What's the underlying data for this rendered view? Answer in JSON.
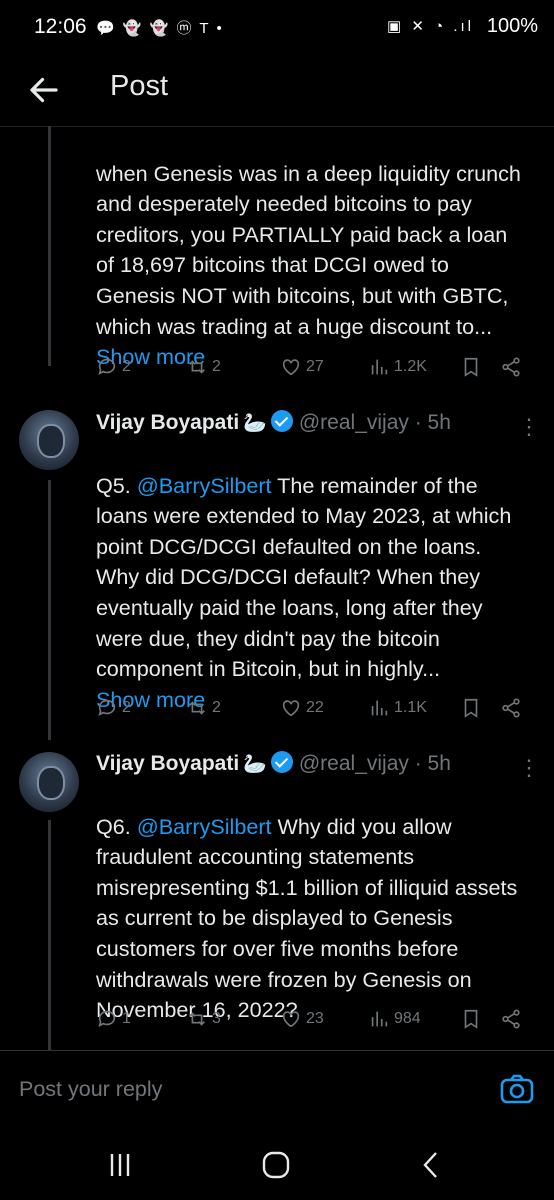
{
  "status_bar": {
    "time": "12:06",
    "notifications": "💬 👻 👻 ⓜ T •",
    "battery": "100%"
  },
  "header": {
    "title": "Post"
  },
  "posts": [
    {
      "text_plain": "when Genesis was in a deep liquidity crunch and desperately needed bitcoins to pay creditors, you PARTIALLY paid back a loan of 18,697 bitcoins that DCGI owed to Genesis NOT with bitcoins, but with GBTC, which was trading at a huge discount to...",
      "show_more": "Show more",
      "replies": "2",
      "reposts": "2",
      "likes": "27",
      "views": "1.2K"
    },
    {
      "name": "Vijay Boyapati",
      "emoji": "🦢",
      "handle": "@real_vijay · 5h",
      "prefix": "Q5.",
      "mention": "@BarrySilbert",
      "text_plain": " The remainder of the loans were extended to May 2023, at which point DCG/DCGI defaulted on the loans. Why did DCG/DCGI default? When they eventually paid the loans, long after they were due, they didn't pay the bitcoin component in Bitcoin, but in highly...",
      "show_more": "Show more",
      "replies": "2",
      "reposts": "2",
      "likes": "22",
      "views": "1.1K"
    },
    {
      "name": "Vijay Boyapati",
      "emoji": "🦢",
      "handle": "@real_vijay · 5h",
      "prefix": "Q6.",
      "mention": "@BarrySilbert",
      "text_plain": " Why did you allow fraudulent accounting statements misrepresenting $1.1 billion of illiquid assets as current to be displayed to Genesis customers for over five months before withdrawals were frozen by Genesis on November 16, 2022?",
      "replies": "1",
      "reposts": "3",
      "likes": "23",
      "views": "984"
    }
  ],
  "reply_bar": {
    "placeholder": "Post your reply"
  },
  "icons": {
    "back": "arrow-left-icon",
    "reply": "reply-icon",
    "repost": "repost-icon",
    "like": "heart-icon",
    "views": "views-icon",
    "bookmark": "bookmark-icon",
    "share": "share-icon",
    "camera": "camera-icon"
  },
  "colors": {
    "accent": "#1d9bf0",
    "background": "#000000",
    "muted": "#71767b"
  }
}
